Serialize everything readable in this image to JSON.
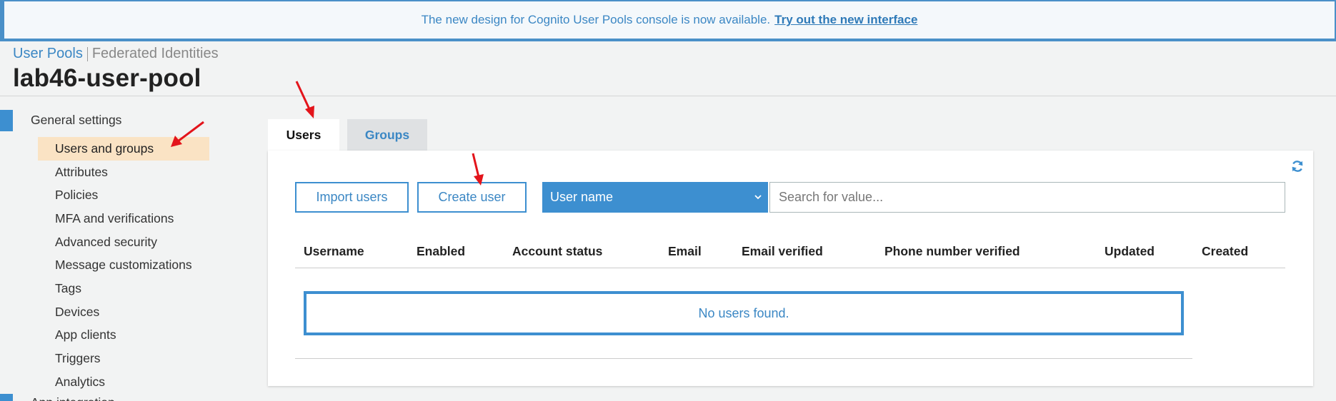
{
  "banner": {
    "message": "The new design for Cognito User Pools console is now available.",
    "link": "Try out the new interface"
  },
  "breadcrumb": {
    "user_pools": "User Pools",
    "federated": "Federated Identities"
  },
  "pool_name": "lab46-user-pool",
  "sidebar": {
    "section": "General settings",
    "items": [
      {
        "label": "Users and groups",
        "active": true
      },
      {
        "label": "Attributes"
      },
      {
        "label": "Policies"
      },
      {
        "label": "MFA and verifications"
      },
      {
        "label": "Advanced security"
      },
      {
        "label": "Message customizations"
      },
      {
        "label": "Tags"
      },
      {
        "label": "Devices"
      },
      {
        "label": "App clients"
      },
      {
        "label": "Triggers"
      },
      {
        "label": "Analytics"
      }
    ],
    "next_section": "App integration"
  },
  "tabs": {
    "users": "Users",
    "groups": "Groups"
  },
  "toolbar": {
    "import": "Import users",
    "create": "Create user",
    "attribute_selected": "User name",
    "search_placeholder": "Search for value..."
  },
  "table": {
    "columns": [
      "Username",
      "Enabled",
      "Account status",
      "Email",
      "Email verified",
      "Phone number verified",
      "Updated",
      "Created"
    ],
    "empty_message": "No users found."
  },
  "colors": {
    "accent": "#3d8fd0",
    "active_nav": "#fae3c4",
    "annotation_arrow": "#e3141b"
  },
  "icons": {
    "refresh": "refresh-icon",
    "dropdown": "chevron-down-icon"
  }
}
